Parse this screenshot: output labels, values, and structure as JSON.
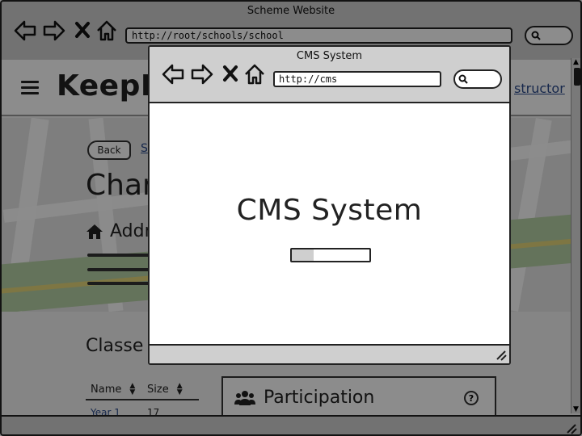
{
  "outer_window": {
    "title": "Scheme Website",
    "address": "http://root/schools/school"
  },
  "page": {
    "brand": "KeepF",
    "instructor_link": "structor",
    "back_label": "Back",
    "breadcrumb_fragment": "S",
    "title_fragment": "Char",
    "address_label": "Addr",
    "classes_title": "Classe",
    "table": {
      "columns": [
        "Name",
        "Size"
      ],
      "rows": [
        {
          "name": "Year 1",
          "size": "17"
        }
      ]
    },
    "panel": {
      "title": "Participation",
      "help": "?"
    }
  },
  "popup": {
    "title": "CMS System",
    "address": "http://cms",
    "heading": "CMS System",
    "progress_fraction": 0.28
  },
  "icons": {
    "back": "arrow-left-icon",
    "forward": "arrow-right-icon",
    "stop": "close-icon",
    "home": "home-icon",
    "search": "search-icon",
    "menu": "hamburger-icon",
    "address": "home-icon",
    "participation": "users-icon",
    "help": "question-icon",
    "resize": "resize-grip-icon"
  },
  "colors": {
    "chrome": "#cfcfcf",
    "link": "#2a4a8a",
    "overlay": "rgba(0,0,0,0.45)"
  }
}
